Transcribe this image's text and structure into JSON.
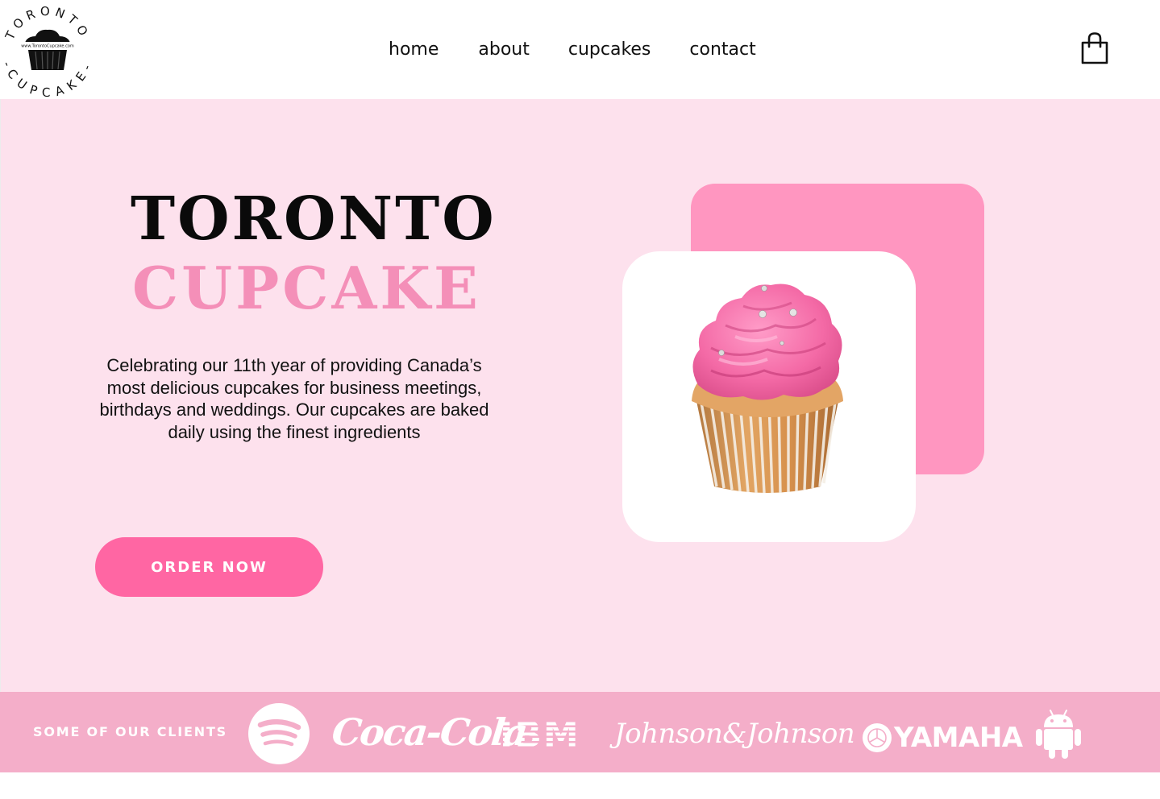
{
  "brand": {
    "logo_top_text": "TORONTO",
    "logo_bottom_text": "-CUPCAKE-",
    "logo_url_text": "www.TorontoCupcake.com"
  },
  "nav": {
    "items": [
      {
        "label": "home"
      },
      {
        "label": "about"
      },
      {
        "label": "cupcakes"
      },
      {
        "label": "contact"
      }
    ],
    "cart_icon": "shopping-bag-icon"
  },
  "hero": {
    "title_line1": "TORONTO",
    "title_line2": "CUPCAKE",
    "description": "Celebrating our 11th year of providing Canada’s most delicious cupcakes for business meetings, birthdays and weddings. Our cupcakes are baked daily using the finest ingredients",
    "cta_label": "ORDER NOW",
    "image": "pink-frosted-cupcake"
  },
  "clients": {
    "label": "SOME OF OUR CLIENTS",
    "logos": [
      {
        "name": "spotify",
        "icon": "spotify-logo"
      },
      {
        "name": "coca-cola",
        "text": "Coca-Cola"
      },
      {
        "name": "ibm",
        "text": "IBM"
      },
      {
        "name": "johnson-and-johnson",
        "text": "Johnson&Johnson"
      },
      {
        "name": "yamaha",
        "text": "YAMAHA"
      },
      {
        "name": "android",
        "icon": "android-logo"
      }
    ]
  },
  "colors": {
    "hero_bg": "#fde1ed",
    "title_accent": "#f48fb8",
    "cta": "#ff66a3",
    "card_back": "#ff96c0",
    "clients_band": "#f4aec9"
  }
}
